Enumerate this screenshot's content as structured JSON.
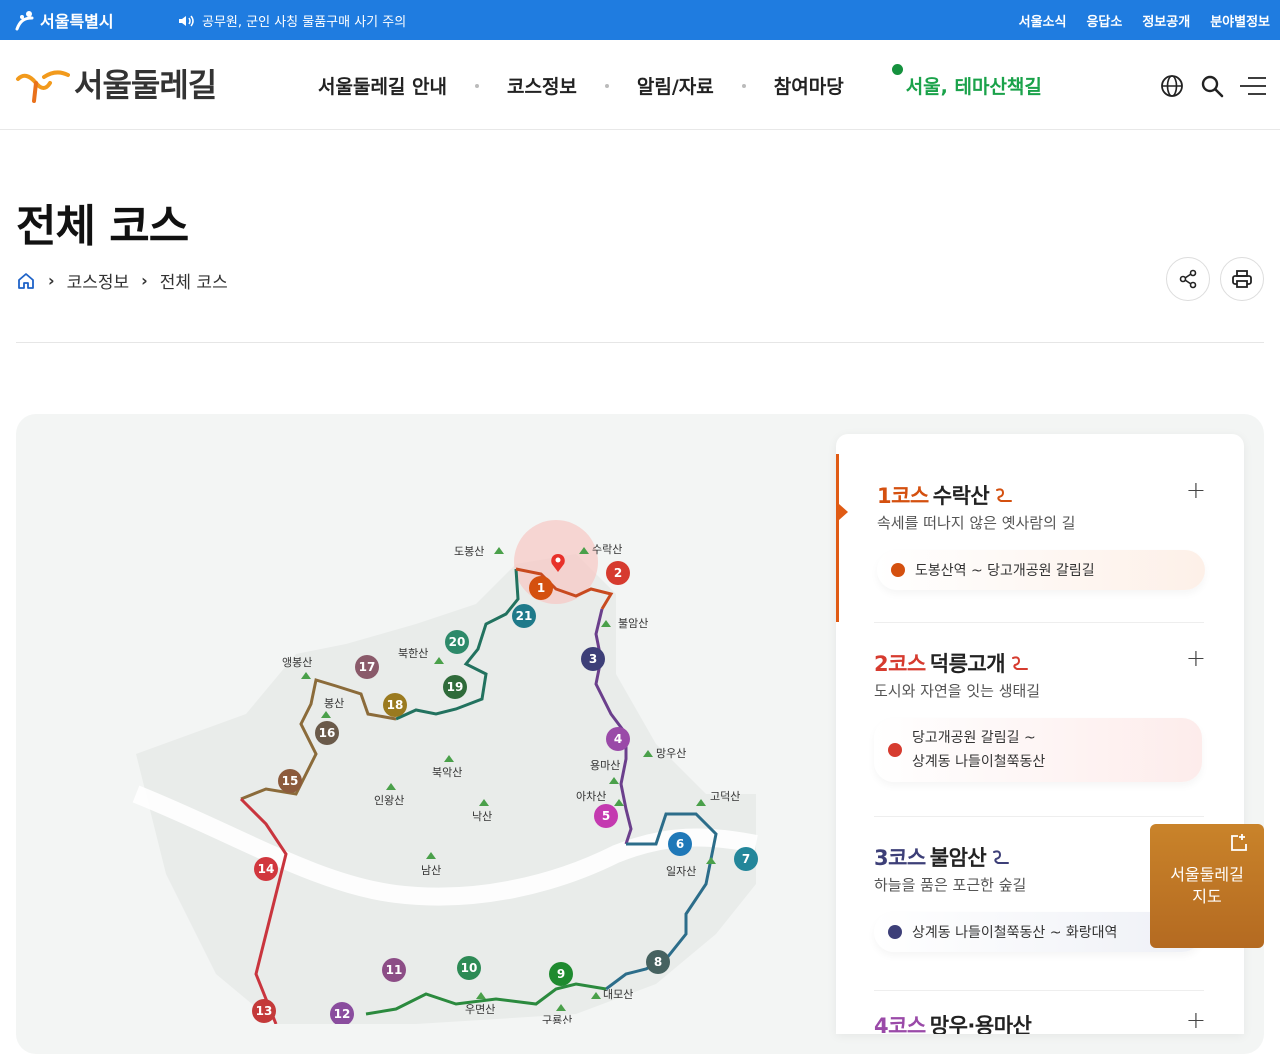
{
  "gov_bar": {
    "logo_text": "서울특별시",
    "notice": "공무원, 군인 사칭 물품구매 사기 주의",
    "links": [
      "서울소식",
      "응답소",
      "정보공개",
      "분야별정보"
    ]
  },
  "header": {
    "brand": "서울둘레길",
    "nav": [
      "서울둘레길 안내",
      "코스정보",
      "알림/자료",
      "참여마당",
      "서울, 테마산책길"
    ]
  },
  "page": {
    "title": "전체 코스",
    "breadcrumb": [
      "코스정보",
      "전체 코스"
    ]
  },
  "map": {
    "mountains": [
      "도봉산",
      "수락산",
      "불암산",
      "북한산",
      "앵봉산",
      "봉산",
      "북악산",
      "인왕산",
      "낙산",
      "남산",
      "용마산",
      "망우산",
      "아차산",
      "고덕산",
      "일자산",
      "대모산",
      "우면산",
      "구룡산"
    ],
    "course_numbers": [
      "1",
      "2",
      "3",
      "4",
      "5",
      "6",
      "7",
      "8",
      "9",
      "10",
      "11",
      "12",
      "13",
      "14",
      "15",
      "16",
      "17",
      "18",
      "19",
      "20",
      "21"
    ]
  },
  "courses": [
    {
      "num": "1코스",
      "name": "수락산",
      "subtitle": "속세를 떠나지 않은 옛사람의 길",
      "route": "도봉산역 ~ 당고개공원 갈림길",
      "color": "#d4500f"
    },
    {
      "num": "2코스",
      "name": "덕릉고개",
      "subtitle": "도시와 자연을 잇는 생태길",
      "route_line1": "당고개공원 갈림길 ~",
      "route_line2": "상계동 나들이철쭉동산",
      "color": "#d63b2f"
    },
    {
      "num": "3코스",
      "name": "불암산",
      "subtitle": "하늘을 품은 포근한 숲길",
      "route": "상계동 나들이철쭉동산 ~ 화랑대역",
      "color": "#3d3f78"
    },
    {
      "num": "4코스",
      "name": "망우·용마산"
    }
  ],
  "float_button": {
    "line1": "서울둘레길",
    "line2": "지도"
  }
}
